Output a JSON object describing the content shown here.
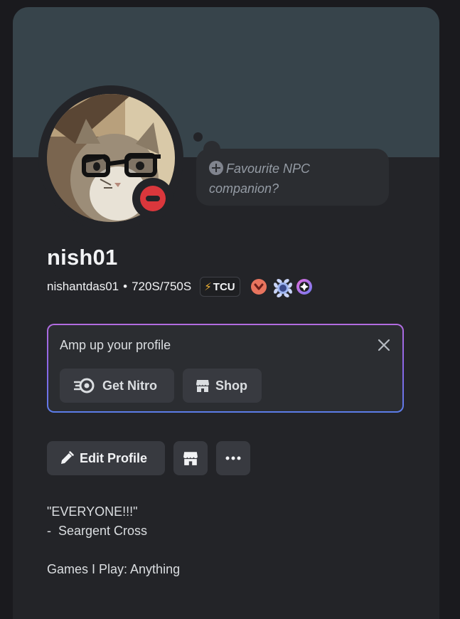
{
  "profile": {
    "display_name": "nish01",
    "username": "nishantdas01",
    "separator": "•",
    "pronouns": "720S/750S",
    "clan_tag": "TCU",
    "status": "do-not-disturb",
    "status_color": "#da373c",
    "banner_color": "#37444b",
    "avatar_icon": "cat-with-glasses-avatar",
    "badges": [
      "hypesquad-bravery-badge",
      "quest-laurel-badge",
      "nitro-gem-badge"
    ]
  },
  "custom_status": {
    "icon": "plus-circle-icon",
    "placeholder": "Favourite NPC companion?"
  },
  "promo": {
    "title": "Amp up your profile",
    "get_nitro_label": "Get Nitro",
    "shop_label": "Shop",
    "border_gradient": [
      "#b26ce0",
      "#5b7ce8"
    ]
  },
  "actions": {
    "edit_profile_label": "Edit Profile",
    "more_label": "···"
  },
  "bio": {
    "line1": "\"EVERYONE!!!\"",
    "line2": "-  Seargent Cross",
    "line3": "",
    "line4": "Games I Play: Anything"
  }
}
